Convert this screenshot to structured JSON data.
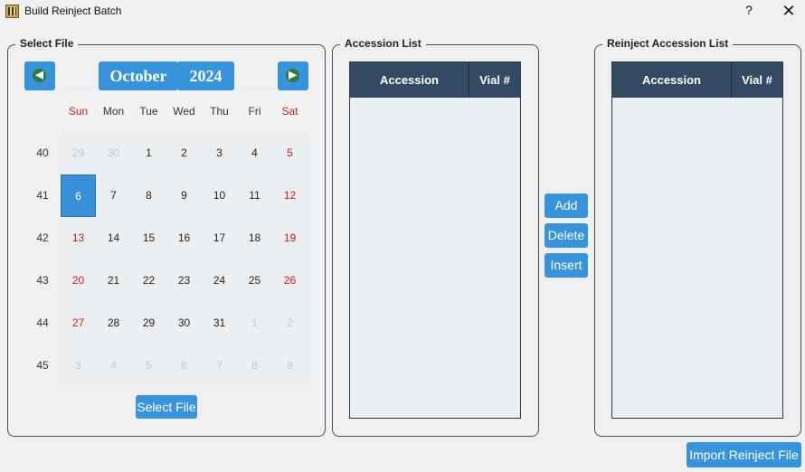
{
  "window": {
    "title": "Build Reinject Batch",
    "help_label": "?",
    "close_label": "✕"
  },
  "select_file": {
    "group_title": "Select File",
    "month": "October",
    "year": "2024",
    "prev_icon": "arrow-left-icon",
    "next_icon": "arrow-right-icon",
    "days_of_week": [
      "Sun",
      "Mon",
      "Tue",
      "Wed",
      "Thu",
      "Fri",
      "Sat"
    ],
    "week_numbers": [
      "40",
      "41",
      "42",
      "43",
      "44",
      "45"
    ],
    "weeks": [
      [
        "29",
        "30",
        "1",
        "2",
        "3",
        "4",
        "5"
      ],
      [
        "6",
        "7",
        "8",
        "9",
        "10",
        "11",
        "12"
      ],
      [
        "13",
        "14",
        "15",
        "16",
        "17",
        "18",
        "19"
      ],
      [
        "20",
        "21",
        "22",
        "23",
        "24",
        "25",
        "26"
      ],
      [
        "27",
        "28",
        "29",
        "30",
        "31",
        "1",
        "2"
      ],
      [
        "3",
        "4",
        "5",
        "6",
        "7",
        "8",
        "9"
      ]
    ],
    "selected_day": "6",
    "select_button": "Select File"
  },
  "accession_list": {
    "group_title": "Accession List",
    "col_accession": "Accession",
    "col_vial": "Vial #",
    "rows": []
  },
  "actions": {
    "add": "Add",
    "delete": "Delete",
    "insert": "Insert"
  },
  "reinject_list": {
    "group_title": "Reinject Accession List",
    "col_accession": "Accession",
    "col_vial": "Vial #",
    "rows": []
  },
  "import_button": "Import Reinject File",
  "colors": {
    "accent": "#3794db",
    "header": "#344a63",
    "weekend": "#d21818",
    "selected": "#3790d8"
  }
}
